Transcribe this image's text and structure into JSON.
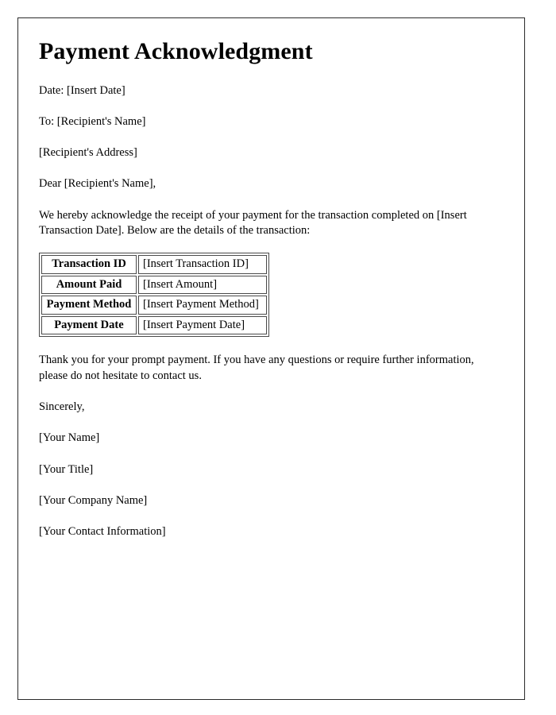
{
  "document": {
    "title": "Payment Acknowledgment",
    "date_line": "Date: [Insert Date]",
    "to_line": "To: [Recipient's Name]",
    "address_line": "[Recipient's Address]",
    "salutation": "Dear [Recipient's Name],",
    "intro_paragraph": "We hereby acknowledge the receipt of your payment for the transaction completed on [Insert Transaction Date]. Below are the details of the transaction:",
    "closing_paragraph": "Thank you for your prompt payment. If you have any questions or require further information, please do not hesitate to contact us.",
    "sign_off": "Sincerely,",
    "signature_block": [
      "[Your Name]",
      "[Your Title]",
      "[Your Company Name]",
      "[Your Contact Information]"
    ]
  },
  "details_table": {
    "rows": [
      {
        "label": "Transaction ID",
        "value": "[Insert Transaction ID]"
      },
      {
        "label": "Amount Paid",
        "value": "[Insert Amount]"
      },
      {
        "label": "Payment Method",
        "value": "[Insert Payment Method]"
      },
      {
        "label": "Payment Date",
        "value": "[Insert Payment Date]"
      }
    ]
  },
  "style": {
    "page_border_color": "#2b2b2b",
    "table_border_color": "#4a4a4a",
    "text_color": "#000000",
    "background_color": "#ffffff"
  }
}
